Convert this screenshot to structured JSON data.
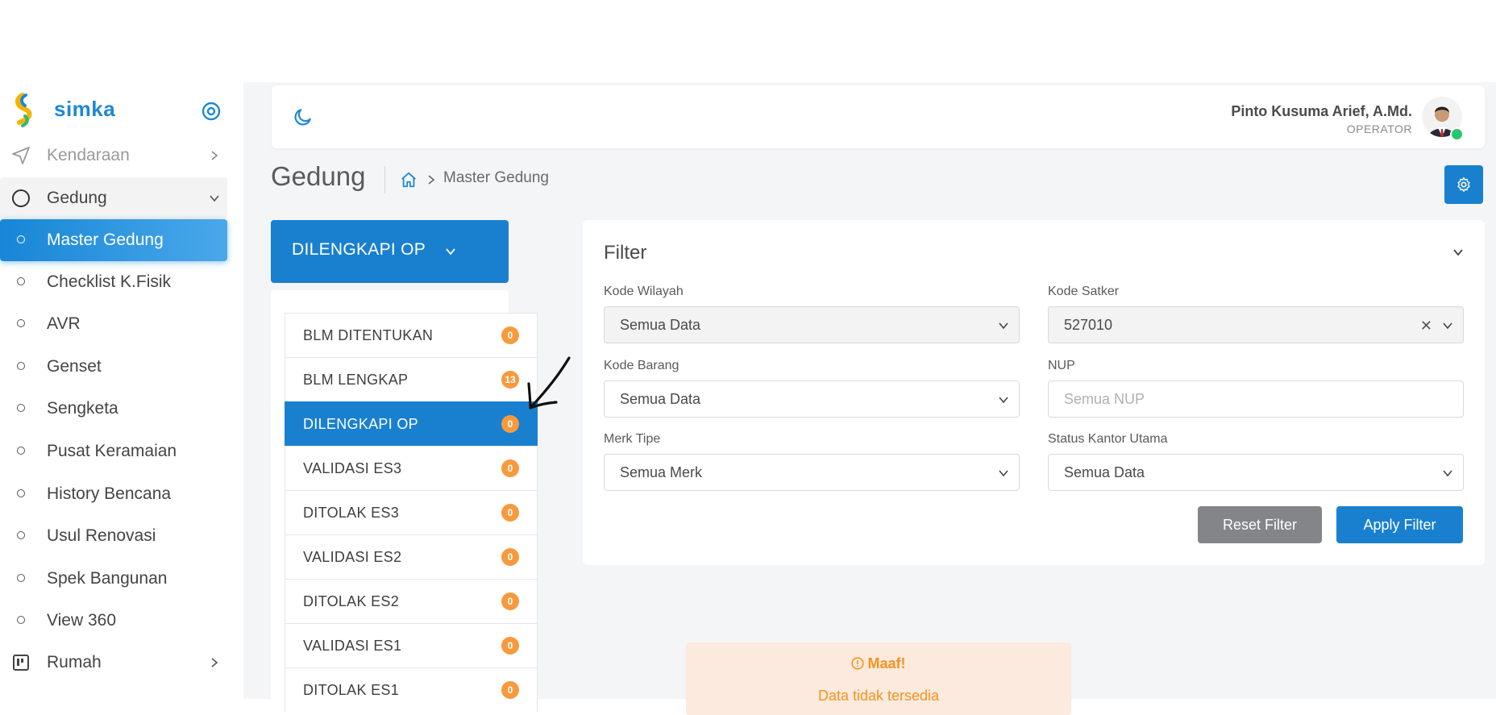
{
  "brand": {
    "name": "simka"
  },
  "sidebar": {
    "items": [
      {
        "label": "Kendaraan"
      },
      {
        "label": "Gedung"
      },
      {
        "label": "Master Gedung"
      },
      {
        "label": "Checklist K.Fisik"
      },
      {
        "label": "AVR"
      },
      {
        "label": "Genset"
      },
      {
        "label": "Sengketa"
      },
      {
        "label": "Pusat Keramaian"
      },
      {
        "label": "History Bencana"
      },
      {
        "label": "Usul Renovasi"
      },
      {
        "label": "Spek Bangunan"
      },
      {
        "label": "View 360"
      },
      {
        "label": "Rumah"
      }
    ]
  },
  "header": {
    "user_name": "Pinto Kusuma Arief, A.Md.",
    "user_role": "OPERATOR"
  },
  "page": {
    "title": "Gedung",
    "breadcrumb": "Master Gedung"
  },
  "status": {
    "selected": "DILENGKAPI OP",
    "items": [
      {
        "label": "BLM DITENTUKAN",
        "count": "0"
      },
      {
        "label": "BLM LENGKAP",
        "count": "13"
      },
      {
        "label": "DILENGKAPI OP",
        "count": "0"
      },
      {
        "label": "VALIDASI ES3",
        "count": "0"
      },
      {
        "label": "DITOLAK ES3",
        "count": "0"
      },
      {
        "label": "VALIDASI ES2",
        "count": "0"
      },
      {
        "label": "DITOLAK ES2",
        "count": "0"
      },
      {
        "label": "VALIDASI ES1",
        "count": "0"
      },
      {
        "label": "DITOLAK ES1",
        "count": "0"
      }
    ]
  },
  "filter": {
    "title": "Filter",
    "kode_wilayah": {
      "label": "Kode Wilayah",
      "value": "Semua Data"
    },
    "kode_satker": {
      "label": "Kode Satker",
      "value": "527010"
    },
    "kode_barang": {
      "label": "Kode Barang",
      "value": "Semua Data"
    },
    "nup": {
      "label": "NUP",
      "placeholder": "Semua NUP"
    },
    "merk_tipe": {
      "label": "Merk Tipe",
      "value": "Semua Merk"
    },
    "status_kantor": {
      "label": "Status Kantor Utama",
      "value": "Semua Data"
    },
    "reset_label": "Reset Filter",
    "apply_label": "Apply Filter"
  },
  "alert": {
    "title": "Maaf!",
    "message": "Data tidak tersedia"
  },
  "colors": {
    "primary": "#1980cf",
    "badge": "#f79a3e",
    "alert_bg": "#fbeadd",
    "alert_text": "#f5931f"
  },
  "icons": [
    "simka-logo-icon",
    "sidebar-toggle-icon",
    "send-icon",
    "circle-icon",
    "chevron-right-icon",
    "chevron-down-icon",
    "moon-icon",
    "home-icon",
    "gear-icon",
    "kanban-icon",
    "alert-circle-icon"
  ]
}
